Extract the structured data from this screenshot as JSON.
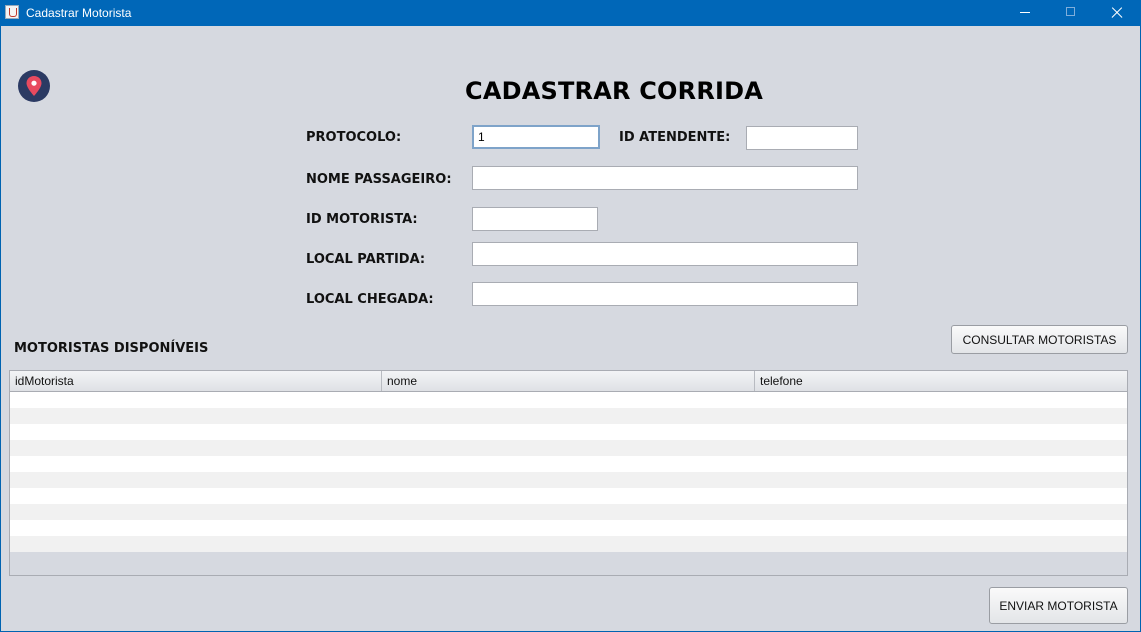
{
  "window": {
    "title": "Cadastrar Motorista"
  },
  "form": {
    "title": "CADASTRAR CORRIDA",
    "protocolo_label": "PROTOCOLO:",
    "protocolo_value": "1",
    "id_atendente_label": "ID ATENDENTE:",
    "id_atendente_value": "",
    "nome_passageiro_label": "NOME PASSAGEIRO:",
    "nome_passageiro_value": "",
    "id_motorista_label": "ID MOTORISTA:",
    "id_motorista_value": "",
    "local_partida_label": "LOCAL PARTIDA:",
    "local_partida_value": "",
    "local_chegada_label": "LOCAL CHEGADA:",
    "local_chegada_value": ""
  },
  "motoristas": {
    "section_label": "MOTORISTAS DISPONÍVEIS",
    "consultar_label": "CONSULTAR MOTORISTAS",
    "columns": [
      "idMotorista",
      "nome",
      "telefone"
    ],
    "rows": []
  },
  "enviar_label": "ENVIAR MOTORISTA",
  "colors": {
    "titlebar": "#0067b8",
    "background": "#d6d9e0",
    "logo_bg": "#2b3a63",
    "pin": "#e84a5f"
  },
  "icons": {
    "logo": "map-pin-icon",
    "app": "java-cup-icon"
  }
}
